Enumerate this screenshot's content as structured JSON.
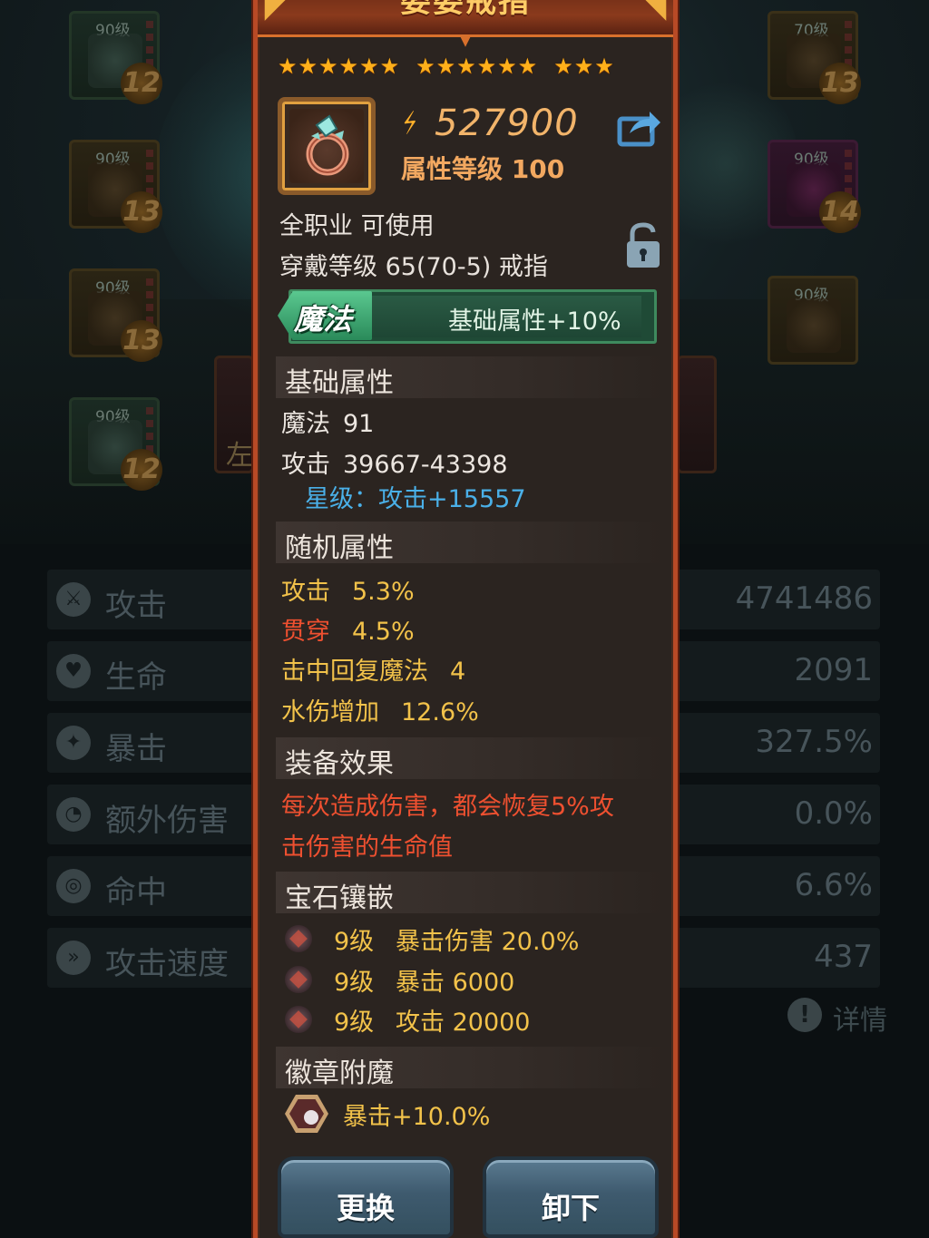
{
  "panel": {
    "title": "娄娄戒指",
    "stars": [
      6,
      6,
      3
    ],
    "power": "527900",
    "attr_level": "属性等级 100",
    "job": "全职业 可使用",
    "wear": "穿戴等级 65(70-5) 戒指",
    "element_tag": "魔法",
    "element_bonus": "基础属性+10%",
    "sections": {
      "base": "基础属性",
      "random": "随机属性",
      "effect": "装备效果",
      "gems": "宝石镶嵌",
      "badge": "徽章附魔"
    },
    "base_stats": [
      {
        "label": "魔法",
        "value": "91"
      },
      {
        "label": "攻击",
        "value": "39667-43398"
      }
    ],
    "star_bonus": "星级：攻击+15557",
    "random_stats": [
      {
        "label": "攻击",
        "value": "5.3%"
      },
      {
        "label": "贯穿",
        "value": "4.5%"
      },
      {
        "label": "击中回复魔法",
        "value": "4"
      },
      {
        "label": "水伤增加",
        "value": "12.6%"
      }
    ],
    "effect_lines": [
      "每次造成伤害，都会恢复5%攻",
      "击伤害的生命值"
    ],
    "gems": [
      {
        "level": "9级",
        "desc": "暴击伤害 20.0%"
      },
      {
        "level": "9级",
        "desc": "暴击 6000"
      },
      {
        "level": "9级",
        "desc": "攻击 20000"
      }
    ],
    "badge": "暴击+10.0%",
    "buttons": {
      "replace": "更换",
      "unequip": "卸下"
    },
    "colors": {
      "border": "#b84a26",
      "gold_text": "#f2c24a",
      "effect_red": "#ee5030",
      "star_blue": "#4ab0e8",
      "element_green": "#3e8a5e"
    }
  },
  "background": {
    "slots": [
      {
        "level": "90级",
        "enhance": "12"
      },
      {
        "level": "90级",
        "enhance": "13"
      },
      {
        "level": "90级",
        "enhance": "13"
      },
      {
        "level": "90级",
        "enhance": "12"
      },
      {
        "level": "70级",
        "enhance": "13"
      },
      {
        "level": "90级",
        "enhance": "14"
      },
      {
        "level": "90级",
        "enhance": ""
      }
    ],
    "side_card_text": "左",
    "stats": [
      {
        "label": "攻击",
        "value": "4741486"
      },
      {
        "label": "生命",
        "value": "2091"
      },
      {
        "label": "暴击",
        "value": "327.5%"
      },
      {
        "label": "额外伤害",
        "value": "0.0%"
      },
      {
        "label": "命中",
        "value": "6.6%"
      },
      {
        "label": "攻击速度",
        "value": "437"
      }
    ],
    "detail": "详情"
  }
}
